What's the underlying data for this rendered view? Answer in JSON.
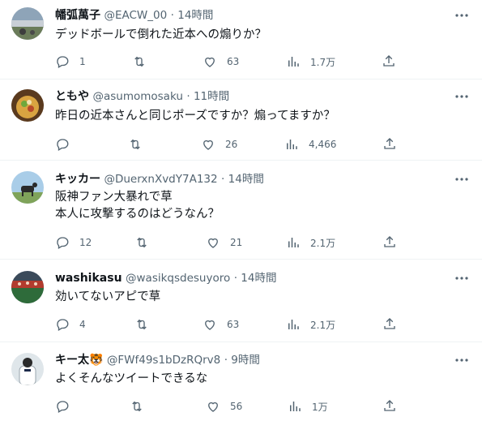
{
  "tweets": [
    {
      "name": "幡弧萬子",
      "handle": "@EACW_00",
      "time": "14時間",
      "lines": [
        "デッドボールで倒れた近本への煽りか？"
      ],
      "reply": "1",
      "retweet": "",
      "like": "63",
      "views": "1.7万",
      "avatar": "avatar-stadium"
    },
    {
      "name": "ともや",
      "handle": "@asumomosaku",
      "time": "11時間",
      "lines": [
        "昨日の近本さんと同じポーズですか？煽ってますか？"
      ],
      "reply": "",
      "retweet": "",
      "like": "26",
      "views": "4,466",
      "avatar": "avatar-food"
    },
    {
      "name": "キッカー",
      "handle": "@DuerxnXvdY7A132",
      "time": "14時間",
      "lines": [
        "阪神ファン大暴れで草",
        "本人に攻撃するのはどうなん？"
      ],
      "reply": "12",
      "retweet": "",
      "like": "21",
      "views": "2.1万",
      "avatar": "avatar-horse"
    },
    {
      "name": "washikasu",
      "handle": "@wasikqsdesuyoro",
      "time": "14時間",
      "lines": [
        "効いてないアピで草"
      ],
      "reply": "4",
      "retweet": "",
      "like": "63",
      "views": "2.1万",
      "avatar": "avatar-crowd"
    },
    {
      "name": "キー太🐯",
      "handle": "@FWf49s1bDzRQrv8",
      "time": "9時間",
      "lines": [
        "よくそんなツイートできるな"
      ],
      "reply": "",
      "retweet": "",
      "like": "56",
      "views": "1万",
      "avatar": "avatar-player"
    }
  ],
  "colors": {
    "muted": "#536471",
    "text": "#0f1419",
    "divider": "#eff3f4"
  },
  "icons": [
    "reply-icon",
    "retweet-icon",
    "like-icon",
    "views-icon",
    "share-icon",
    "more-icon"
  ]
}
